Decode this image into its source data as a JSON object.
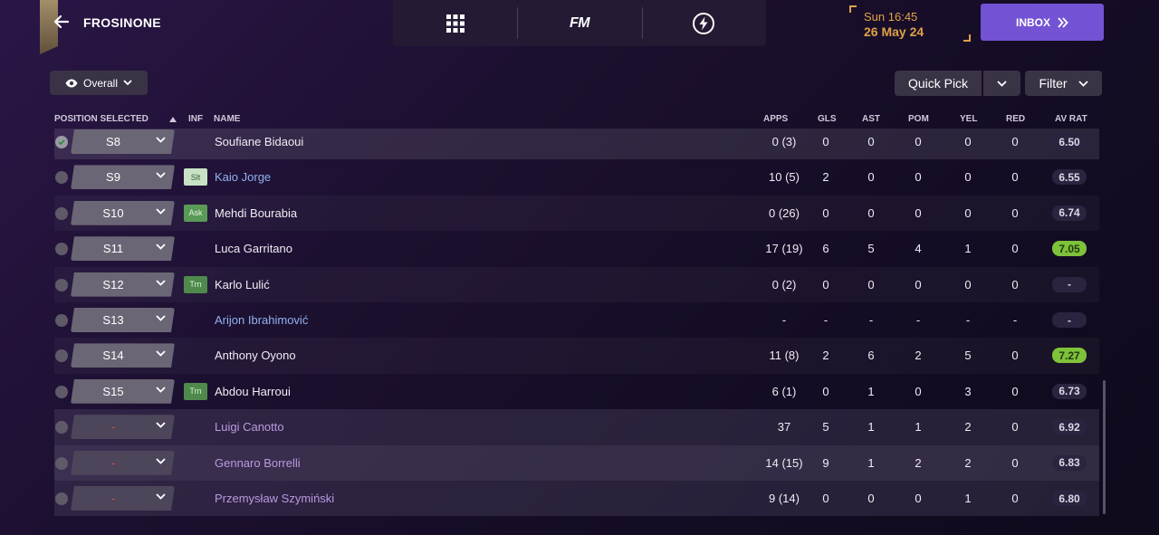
{
  "header": {
    "club_name": "FROSINONE",
    "time": "Sun 16:45",
    "date": "26 May 24",
    "inbox_label": "INBOX",
    "fm_logo": "FM"
  },
  "controls": {
    "view_label": "Overall",
    "quick_pick_label": "Quick Pick",
    "filter_label": "Filter"
  },
  "table": {
    "columns": {
      "position": "POSITION SELECTED",
      "inf": "INF",
      "name": "NAME",
      "apps": "APPS",
      "gls": "GLS",
      "ast": "AST",
      "pom": "POM",
      "yel": "YEL",
      "red": "RED",
      "avrat": "AV RAT"
    },
    "rows": [
      {
        "pos": "S8",
        "inf": "",
        "name": "Soufiane Bidaoui",
        "apps": "0 (3)",
        "gls": "0",
        "ast": "0",
        "pom": "0",
        "yel": "0",
        "red": "0",
        "rat": "6.50"
      },
      {
        "pos": "S9",
        "inf": "Slt",
        "name": "Kaio Jorge",
        "apps": "10 (5)",
        "gls": "2",
        "ast": "0",
        "pom": "0",
        "yel": "0",
        "red": "0",
        "rat": "6.55"
      },
      {
        "pos": "S10",
        "inf": "Ask",
        "name": "Mehdi Bourabia",
        "apps": "0 (26)",
        "gls": "0",
        "ast": "0",
        "pom": "0",
        "yel": "0",
        "red": "0",
        "rat": "6.74"
      },
      {
        "pos": "S11",
        "inf": "",
        "name": "Luca Garritano",
        "apps": "17 (19)",
        "gls": "6",
        "ast": "5",
        "pom": "4",
        "yel": "1",
        "red": "0",
        "rat": "7.05"
      },
      {
        "pos": "S12",
        "inf": "Trn",
        "name": "Karlo Lulić",
        "apps": "0 (2)",
        "gls": "0",
        "ast": "0",
        "pom": "0",
        "yel": "0",
        "red": "0",
        "rat": "-"
      },
      {
        "pos": "S13",
        "inf": "",
        "name": "Arijon Ibrahimović",
        "apps": "-",
        "gls": "-",
        "ast": "-",
        "pom": "-",
        "yel": "-",
        "red": "-",
        "rat": "-"
      },
      {
        "pos": "S14",
        "inf": "",
        "name": "Anthony Oyono",
        "apps": "11 (8)",
        "gls": "2",
        "ast": "6",
        "pom": "2",
        "yel": "5",
        "red": "0",
        "rat": "7.27"
      },
      {
        "pos": "S15",
        "inf": "Trn",
        "name": "Abdou Harroui",
        "apps": "6 (1)",
        "gls": "0",
        "ast": "1",
        "pom": "0",
        "yel": "3",
        "red": "0",
        "rat": "6.73"
      },
      {
        "pos": "-",
        "inf": "",
        "name": "Luigi Canotto",
        "apps": "37",
        "gls": "5",
        "ast": "1",
        "pom": "1",
        "yel": "2",
        "red": "0",
        "rat": "6.92"
      },
      {
        "pos": "-",
        "inf": "",
        "name": "Gennaro Borrelli",
        "apps": "14 (15)",
        "gls": "9",
        "ast": "1",
        "pom": "2",
        "yel": "2",
        "red": "0",
        "rat": "6.83"
      },
      {
        "pos": "-",
        "inf": "",
        "name": "Przemysław Szymiński",
        "apps": "9 (14)",
        "gls": "0",
        "ast": "0",
        "pom": "0",
        "yel": "1",
        "red": "0",
        "rat": "6.80"
      }
    ]
  },
  "colors": {
    "accent": "#7353d4",
    "date": "#e0a247",
    "good_rating": "#7ec13a",
    "link_blue": "#90b2f0",
    "loan_purple": "#b89ae0"
  }
}
